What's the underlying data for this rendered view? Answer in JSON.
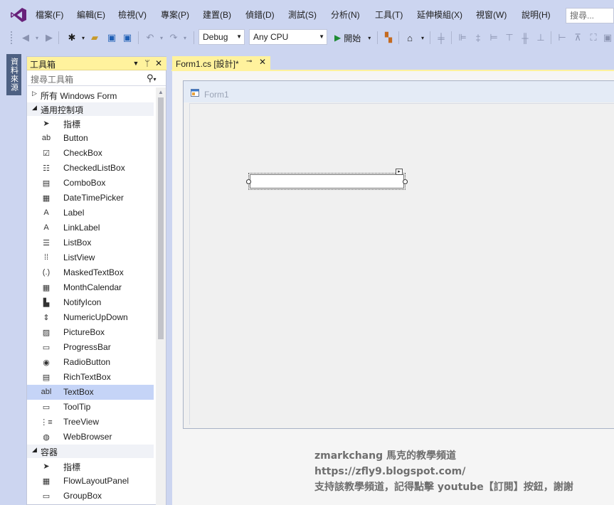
{
  "menu": {
    "items": [
      "檔案(F)",
      "編輯(E)",
      "檢視(V)",
      "專案(P)",
      "建置(B)",
      "偵錯(D)",
      "測試(S)",
      "分析(N)",
      "工具(T)",
      "延伸模組(X)",
      "視窗(W)",
      "說明(H)"
    ],
    "search_placeholder": "搜尋..."
  },
  "toolbar": {
    "config": "Debug",
    "platform": "Any CPU",
    "start_label": "開始"
  },
  "side_tab": {
    "label": "資料來源"
  },
  "toolbox": {
    "title": "工具箱",
    "search_placeholder": "搜尋工具箱",
    "cat_all": "所有 Windows Form",
    "cat_common": "通用控制項",
    "cat_containers": "容器",
    "common_items": [
      {
        "label": "指標",
        "icon": "pointer-icon",
        "glyph": "➤"
      },
      {
        "label": "Button",
        "icon": "button-icon",
        "glyph": "ab"
      },
      {
        "label": "CheckBox",
        "icon": "checkbox-icon",
        "glyph": "☑"
      },
      {
        "label": "CheckedListBox",
        "icon": "checked-list-icon",
        "glyph": "☷"
      },
      {
        "label": "ComboBox",
        "icon": "combobox-icon",
        "glyph": "▤"
      },
      {
        "label": "DateTimePicker",
        "icon": "datetime-icon",
        "glyph": "▦"
      },
      {
        "label": "Label",
        "icon": "label-icon",
        "glyph": "A"
      },
      {
        "label": "LinkLabel",
        "icon": "linklabel-icon",
        "glyph": "A"
      },
      {
        "label": "ListBox",
        "icon": "listbox-icon",
        "glyph": "☰"
      },
      {
        "label": "ListView",
        "icon": "listview-icon",
        "glyph": "⁞⁞"
      },
      {
        "label": "MaskedTextBox",
        "icon": "masked-textbox-icon",
        "glyph": "(.)"
      },
      {
        "label": "MonthCalendar",
        "icon": "calendar-icon",
        "glyph": "▦"
      },
      {
        "label": "NotifyIcon",
        "icon": "notify-icon",
        "glyph": "▙"
      },
      {
        "label": "NumericUpDown",
        "icon": "numeric-updown-icon",
        "glyph": "⇕"
      },
      {
        "label": "PictureBox",
        "icon": "picturebox-icon",
        "glyph": "▨"
      },
      {
        "label": "ProgressBar",
        "icon": "progressbar-icon",
        "glyph": "▭"
      },
      {
        "label": "RadioButton",
        "icon": "radiobutton-icon",
        "glyph": "◉"
      },
      {
        "label": "RichTextBox",
        "icon": "richtextbox-icon",
        "glyph": "▤"
      },
      {
        "label": "TextBox",
        "icon": "textbox-icon",
        "glyph": "abl"
      },
      {
        "label": "ToolTip",
        "icon": "tooltip-icon",
        "glyph": "▭"
      },
      {
        "label": "TreeView",
        "icon": "treeview-icon",
        "glyph": "⋮≡"
      },
      {
        "label": "WebBrowser",
        "icon": "webbrowser-icon",
        "glyph": "◍"
      }
    ],
    "container_items": [
      {
        "label": "指標",
        "icon": "pointer-icon",
        "glyph": "➤"
      },
      {
        "label": "FlowLayoutPanel",
        "icon": "flowlayout-icon",
        "glyph": "▦"
      },
      {
        "label": "GroupBox",
        "icon": "groupbox-icon",
        "glyph": "▭"
      }
    ],
    "selected_item": "TextBox"
  },
  "document": {
    "tab_label": "Form1.cs [設計]*"
  },
  "form": {
    "title": "Form1"
  },
  "watermark": {
    "line1": "zmarkchang 馬克的教學頻道",
    "line2": "https://zfly9.blogspot.com/",
    "line3": "支持該教學頻道，記得點擊 youtube【訂閱】按鈕，謝謝"
  },
  "colors": {
    "chrome": "#CCD5F0",
    "active_tab": "#FFF29D",
    "selection": "#C5D4F7",
    "vs_logo": "#68217A"
  }
}
